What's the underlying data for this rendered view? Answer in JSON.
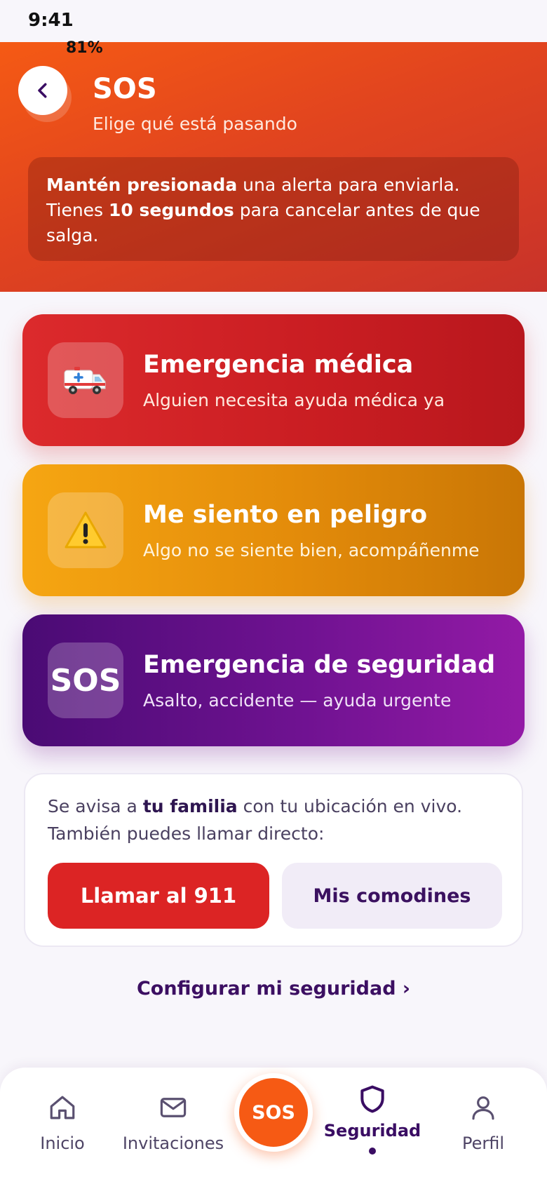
{
  "status_bar": {
    "time": "9:41",
    "battery": "81%"
  },
  "header": {
    "title": "SOS",
    "subtitle": "Elige qué está pasando"
  },
  "notice": {
    "bold1": "Mantén presionada",
    "text1": " una alerta para enviarla. Tienes ",
    "bold2": "10 segundos",
    "text2": " para cancelar antes de que salga."
  },
  "alerts": [
    {
      "title": "Emergencia médica",
      "description": "Alguien necesita ayuda médica ya",
      "icon": "ambulance-icon",
      "color": "#dc2a2c"
    },
    {
      "title": "Me siento en peligro",
      "description": "Algo no se siente bien, acompáñenme",
      "icon": "warning-icon",
      "color": "#f6a612"
    },
    {
      "title": "Emergencia de seguridad",
      "description": "Asalto, accidente — ayuda urgente",
      "icon_text": "SOS",
      "color": "#6f1291"
    }
  ],
  "family": {
    "text1": "Se avisa a ",
    "bold": "tu familia",
    "text2": " con tu ubicación en vivo. También puedes llamar directo:",
    "call_label": "Llamar al 911",
    "comodines_label": "Mis comodines"
  },
  "config_link": "Configurar mi seguridad ›",
  "nav": {
    "items": [
      {
        "label": "Inicio",
        "icon": "home-icon"
      },
      {
        "label": "Invitaciones",
        "icon": "mail-icon"
      },
      {
        "label": "Seguridad",
        "icon": "shield-icon",
        "active": true
      },
      {
        "label": "Perfil",
        "icon": "user-icon"
      }
    ],
    "sos_label": "SOS"
  },
  "colors": {
    "accent": "#f65a14",
    "primary": "#3a0d63",
    "danger": "#dc2424"
  }
}
